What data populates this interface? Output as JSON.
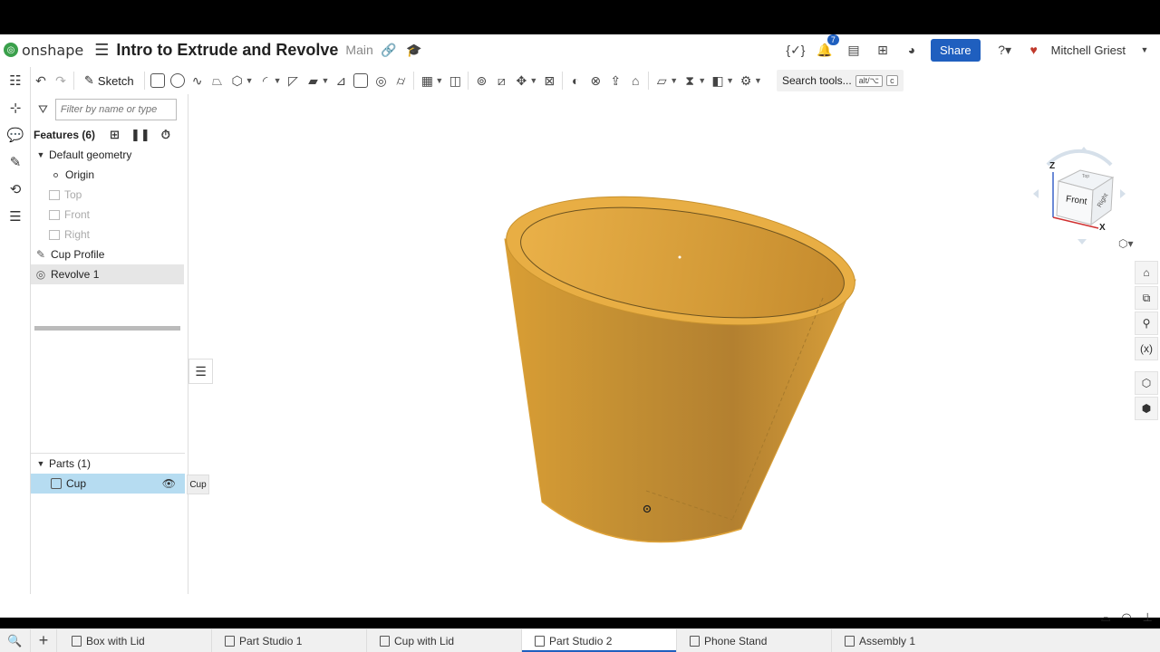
{
  "header": {
    "logo_text": "onshape",
    "doc_title": "Intro to Extrude and Revolve",
    "branch": "Main",
    "notification_count": "7",
    "share_label": "Share",
    "user_name": "Mitchell Griest"
  },
  "toolbar": {
    "sketch_label": "Sketch",
    "search_label": "Search tools...",
    "shortcut_1": "alt/⌥",
    "shortcut_2": "c"
  },
  "feature_panel": {
    "filter_placeholder": "Filter by name or type",
    "features_title": "Features (6)",
    "default_geometry": "Default geometry",
    "origin": "Origin",
    "planes": [
      "Top",
      "Front",
      "Right"
    ],
    "features": [
      "Cup Profile",
      "Revolve 1"
    ],
    "parts_title": "Parts (1)",
    "part_name": "Cup",
    "tooltip": "Cup"
  },
  "viewcube": {
    "front": "Front",
    "right": "Right",
    "top": "Top",
    "axis_z": "Z",
    "axis_x": "X"
  },
  "tabs": [
    "Box with Lid",
    "Part Studio 1",
    "Cup with Lid",
    "Part Studio 2",
    "Phone Stand",
    "Assembly 1"
  ],
  "active_tab": "Part Studio 2",
  "colors": {
    "accent": "#1f5fbf",
    "part": "#e6a93a",
    "selected_row": "#b6dcf1"
  }
}
